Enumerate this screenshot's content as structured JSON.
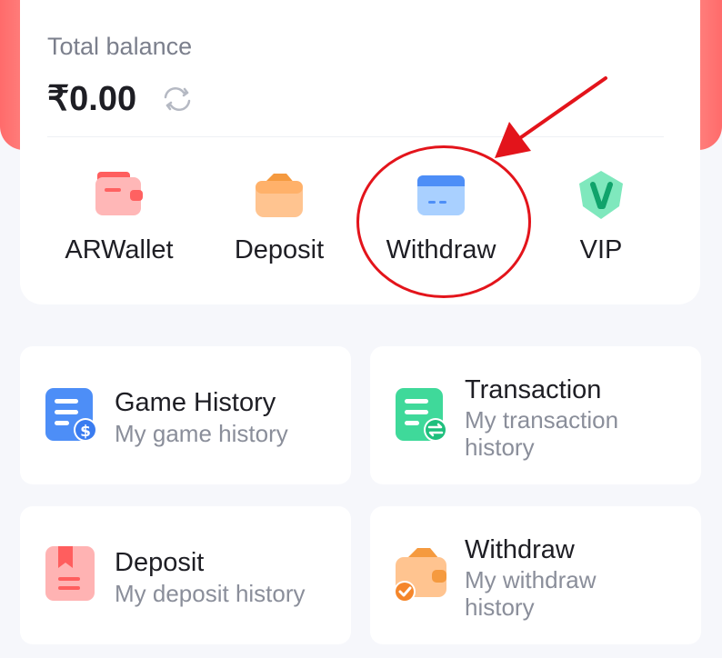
{
  "balance": {
    "label": "Total balance",
    "amount": "₹0.00"
  },
  "actions": [
    {
      "label": "ARWallet",
      "icon": "wallet-red-icon"
    },
    {
      "label": "Deposit",
      "icon": "wallet-orange-icon"
    },
    {
      "label": "Withdraw",
      "icon": "card-blue-icon"
    },
    {
      "label": "VIP",
      "icon": "vip-badge-icon"
    }
  ],
  "tiles": [
    {
      "title": "Game History",
      "sub1": "My game history",
      "sub2": "",
      "icon": "game-history-icon"
    },
    {
      "title": "Transaction",
      "sub1": "My transaction",
      "sub2": "history",
      "icon": "transaction-icon"
    },
    {
      "title": "Deposit",
      "sub1": "My deposit history",
      "sub2": "",
      "icon": "deposit-history-icon"
    },
    {
      "title": "Withdraw",
      "sub1": "My withdraw",
      "sub2": "history",
      "icon": "withdraw-history-icon"
    }
  ],
  "colors": {
    "accent_red": "#e3141b",
    "blue": "#4d8ef7",
    "green": "#3fd99a",
    "orange": "#f7a55a"
  }
}
